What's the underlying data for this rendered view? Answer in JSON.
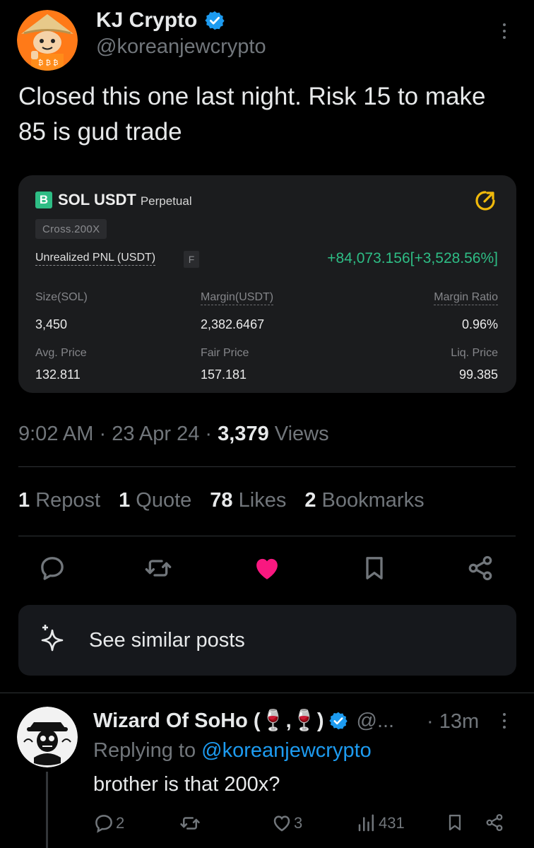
{
  "tweet": {
    "author_name": "KJ Crypto",
    "handle": "@koreanjewcrypto",
    "text": "Closed this one last night. Risk 15 to make 85 is gud trade",
    "time": "9:02 AM",
    "date": "23 Apr 24",
    "views_count": "3,379",
    "views_label": "Views",
    "stats": {
      "reposts_count": "1",
      "reposts_label": "Repost",
      "quotes_count": "1",
      "quotes_label": "Quote",
      "likes_count": "78",
      "likes_label": "Likes",
      "bookmarks_count": "2",
      "bookmarks_label": "Bookmarks"
    }
  },
  "position_card": {
    "logo_letter": "B",
    "pair": "SOL USDT",
    "contract_type": "Perpetual",
    "margin_mode": "Cross.200X",
    "pnl_label": "Unrealized PNL (USDT)",
    "pnl_badge": "F",
    "pnl_value": "+84,073.156[+3,528.56%]",
    "fields": {
      "size_label": "Size(SOL)",
      "size_value": "3,450",
      "margin_label": "Margin(USDT)",
      "margin_value": "2,382.6467",
      "margin_ratio_label": "Margin Ratio",
      "margin_ratio_value": "0.96%",
      "avg_price_label": "Avg. Price",
      "avg_price_value": "132.811",
      "fair_price_label": "Fair Price",
      "fair_price_value": "157.181",
      "liq_price_label": "Liq. Price",
      "liq_price_value": "99.385"
    }
  },
  "see_similar": {
    "label": "See similar posts"
  },
  "reply": {
    "author_name": "Wizard Of SoHo (🍷,🍷)",
    "handle": "@...",
    "time": "· 13m",
    "replying_prefix": "Replying to",
    "replying_to": "@koreanjewcrypto",
    "text": "brother is that 200x?",
    "replies_count": "2",
    "likes_count": "3",
    "views_count": "431"
  },
  "colors": {
    "background": "#000000",
    "verified": "#1d9bf0",
    "like_active": "#f91880",
    "profit": "#2ebd85",
    "secondary_text": "#71767b"
  }
}
